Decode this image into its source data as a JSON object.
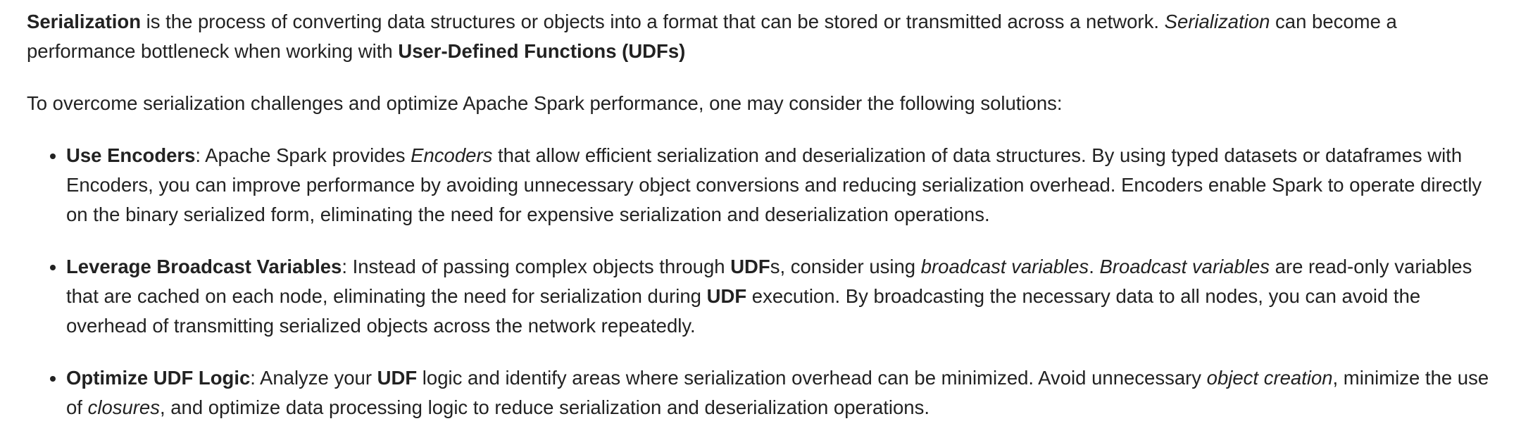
{
  "intro": {
    "p1": [
      {
        "t": "Serialization",
        "s": "b"
      },
      {
        "t": " is the process of converting data structures or objects into a format that can be stored or transmitted across a network. "
      },
      {
        "t": "Serialization",
        "s": "i"
      },
      {
        "t": " can become a performance bottleneck when working with "
      },
      {
        "t": "User-Defined Functions (UDFs)",
        "s": "b"
      }
    ],
    "p2": "To overcome serialization challenges and optimize Apache Spark performance, one may consider the following solutions:"
  },
  "solutions": [
    [
      {
        "t": "Use Encoders",
        "s": "b"
      },
      {
        "t": ": Apache Spark provides "
      },
      {
        "t": "Encoders",
        "s": "i"
      },
      {
        "t": " that allow efficient serialization and deserialization of data structures. By using typed datasets or dataframes with Encoders, you can improve performance by avoiding unnecessary object conversions and reducing serialization overhead. Encoders enable Spark to operate directly on the binary serialized form, eliminating the need for expensive serialization and deserialization operations."
      }
    ],
    [
      {
        "t": "Leverage Broadcast Variables",
        "s": "b"
      },
      {
        "t": ": Instead of passing complex objects through "
      },
      {
        "t": "UDF",
        "s": "b"
      },
      {
        "t": "s, consider using "
      },
      {
        "t": "broadcast variables",
        "s": "i"
      },
      {
        "t": ". "
      },
      {
        "t": "Broadcast variables",
        "s": "i"
      },
      {
        "t": " are read-only variables that are cached on each node, eliminating the need for serialization during "
      },
      {
        "t": "UDF",
        "s": "b"
      },
      {
        "t": " execution. By broadcasting the necessary data to all nodes, you can avoid the overhead of transmitting serialized objects across the network repeatedly."
      }
    ],
    [
      {
        "t": "Optimize UDF Logic",
        "s": "b"
      },
      {
        "t": ": Analyze your "
      },
      {
        "t": "UDF",
        "s": "b"
      },
      {
        "t": " logic and identify areas where serialization overhead can be minimized. Avoid unnecessary "
      },
      {
        "t": "object creation",
        "s": "i"
      },
      {
        "t": ", minimize the use of "
      },
      {
        "t": "closures",
        "s": "i"
      },
      {
        "t": ", and optimize data processing logic to reduce serialization and deserialization operations."
      }
    ]
  ]
}
